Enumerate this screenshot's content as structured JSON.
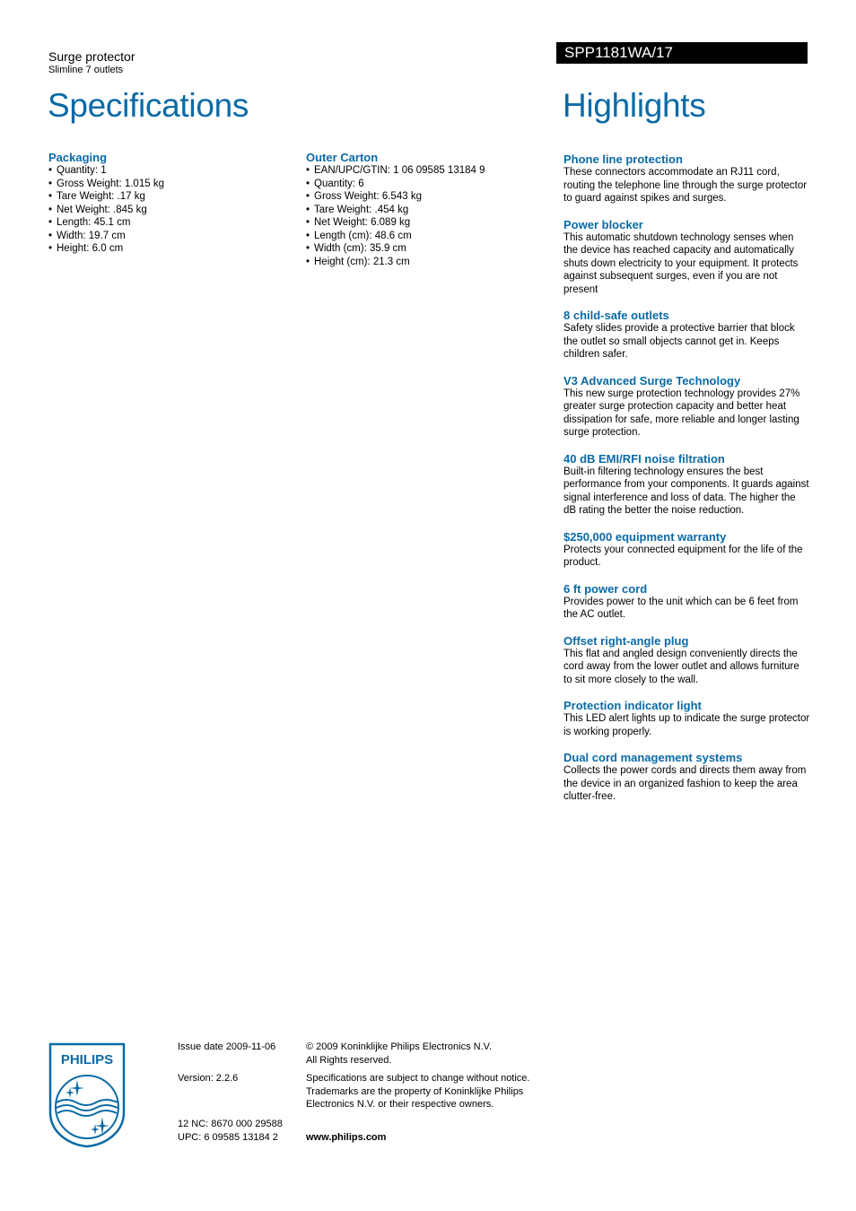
{
  "header": {
    "product_category": "Surge protector",
    "product_subtitle": "Slimline 7 outlets",
    "model_number": "SPP1181WA/17",
    "specifications_title": "Specifications",
    "highlights_title": "Highlights"
  },
  "specifications": {
    "packaging": {
      "heading": "Packaging",
      "items": [
        "Quantity: 1",
        "Gross Weight: 1.015 kg",
        "Tare Weight: .17 kg",
        "Net Weight: .845 kg",
        "Length: 45.1 cm",
        "Width: 19.7 cm",
        "Height: 6.0 cm"
      ]
    },
    "outer_carton": {
      "heading": "Outer Carton",
      "items": [
        "EAN/UPC/GTIN: 1 06 09585 13184 9",
        "Quantity: 6",
        "Gross Weight: 6.543 kg",
        "Tare Weight: .454 kg",
        "Net Weight: 6.089 kg",
        "Length (cm): 48.6 cm",
        "Width (cm): 35.9 cm",
        "Height (cm): 21.3 cm"
      ]
    }
  },
  "highlights": [
    {
      "title": "Phone line protection",
      "body": "These connectors accommodate an RJ11 cord, routing the telephone line through the surge protector to guard against spikes and surges."
    },
    {
      "title": "Power blocker",
      "body": "This automatic shutdown technology senses when the device has reached capacity and automatically shuts down electricity to your equipment. It protects against subsequent surges, even if you are not present"
    },
    {
      "title": "8 child-safe outlets",
      "body": "Safety slides provide a protective barrier that block the outlet so small objects cannot get in. Keeps children safer."
    },
    {
      "title": "V3 Advanced Surge Technology",
      "body": "This new surge protection technology provides 27% greater surge protection capacity and better heat dissipation for safe, more reliable and longer lasting surge protection."
    },
    {
      "title": "40 dB EMI/RFI noise filtration",
      "body": "Built-in filtering technology ensures the best performance from your components. It guards against signal interference and loss of data. The higher the dB rating the better the noise reduction."
    },
    {
      "title": "$250,000 equipment warranty",
      "body": "Protects your connected equipment for the life of the product."
    },
    {
      "title": "6 ft power cord",
      "body": "Provides power to the unit which can be 6 feet from the AC outlet."
    },
    {
      "title": "Offset right-angle plug",
      "body": "This flat and angled design conveniently directs the cord away from the lower outlet and allows furniture to sit more closely to the wall."
    },
    {
      "title": "Protection indicator light",
      "body": "This LED alert lights up to indicate the surge protector is working properly."
    },
    {
      "title": "Dual cord management systems",
      "body": "Collects the power cords and directs them away from the device in an organized fashion to keep the area clutter-free."
    }
  ],
  "footer": {
    "logo_text": "PHILIPS",
    "issue_date": "Issue date 2009-11-06",
    "version": "Version: 2.2.6",
    "nc": "12 NC: 8670 000 29588",
    "upc": "UPC: 6 09585 13184 2",
    "copyright_line1": "© 2009 Koninklijke Philips Electronics N.V.",
    "copyright_line2": "All Rights reserved.",
    "notice_line1": "Specifications are subject to change without notice.",
    "notice_line2": "Trademarks are the property of Koninklijke Philips",
    "notice_line3": "Electronics N.V. or their respective owners.",
    "website": "www.philips.com"
  },
  "colors": {
    "brand_blue": "#0a6aa6",
    "model_bar": "#000000"
  }
}
